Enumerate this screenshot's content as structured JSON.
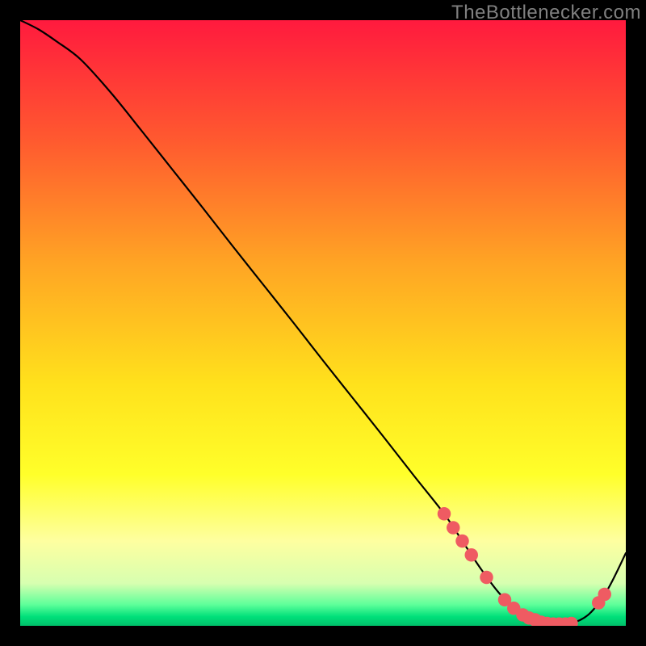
{
  "watermark": "TheBottlenecker.com",
  "chart_data": {
    "type": "line",
    "title": "",
    "xlabel": "",
    "ylabel": "",
    "xlim": [
      0,
      100
    ],
    "ylim": [
      0,
      100
    ],
    "background_gradient": {
      "stops": [
        {
          "offset": 0.0,
          "color": "#ff1a3e"
        },
        {
          "offset": 0.2,
          "color": "#ff5a2f"
        },
        {
          "offset": 0.4,
          "color": "#ffa424"
        },
        {
          "offset": 0.6,
          "color": "#ffe11c"
        },
        {
          "offset": 0.75,
          "color": "#ffff2a"
        },
        {
          "offset": 0.86,
          "color": "#feffa0"
        },
        {
          "offset": 0.93,
          "color": "#d7ffb0"
        },
        {
          "offset": 0.965,
          "color": "#5eff9a"
        },
        {
          "offset": 0.985,
          "color": "#00e07a"
        },
        {
          "offset": 1.0,
          "color": "#00c06a"
        }
      ]
    },
    "series": [
      {
        "name": "bottleneck-curve",
        "x": [
          0,
          3,
          6,
          10,
          15,
          20,
          25,
          30,
          35,
          40,
          45,
          50,
          55,
          60,
          65,
          70,
          73,
          76,
          79,
          82,
          85,
          88,
          91,
          94,
          97,
          100
        ],
        "y": [
          100,
          98.5,
          96.5,
          93.5,
          88.0,
          81.8,
          75.5,
          69.2,
          62.8,
          56.5,
          50.2,
          43.8,
          37.5,
          31.2,
          24.8,
          18.5,
          14.0,
          9.5,
          5.5,
          2.5,
          1.0,
          0.3,
          0.4,
          2.0,
          6.0,
          12.0
        ]
      }
    ],
    "markers": {
      "name": "highlighted-points",
      "points": [
        {
          "x": 70.0,
          "y": 18.5
        },
        {
          "x": 71.5,
          "y": 16.2
        },
        {
          "x": 73.0,
          "y": 14.0
        },
        {
          "x": 74.5,
          "y": 11.7
        },
        {
          "x": 77.0,
          "y": 8.0
        },
        {
          "x": 80.0,
          "y": 4.3
        },
        {
          "x": 81.5,
          "y": 2.9
        },
        {
          "x": 83.0,
          "y": 1.8
        },
        {
          "x": 84.0,
          "y": 1.3
        },
        {
          "x": 85.0,
          "y": 1.0
        },
        {
          "x": 86.0,
          "y": 0.6
        },
        {
          "x": 87.0,
          "y": 0.4
        },
        {
          "x": 88.0,
          "y": 0.3
        },
        {
          "x": 89.0,
          "y": 0.3
        },
        {
          "x": 90.0,
          "y": 0.3
        },
        {
          "x": 91.0,
          "y": 0.4
        },
        {
          "x": 95.5,
          "y": 3.8
        },
        {
          "x": 96.5,
          "y": 5.2
        }
      ],
      "radius_data_units": 1.1,
      "color": "#ef5b62"
    }
  }
}
